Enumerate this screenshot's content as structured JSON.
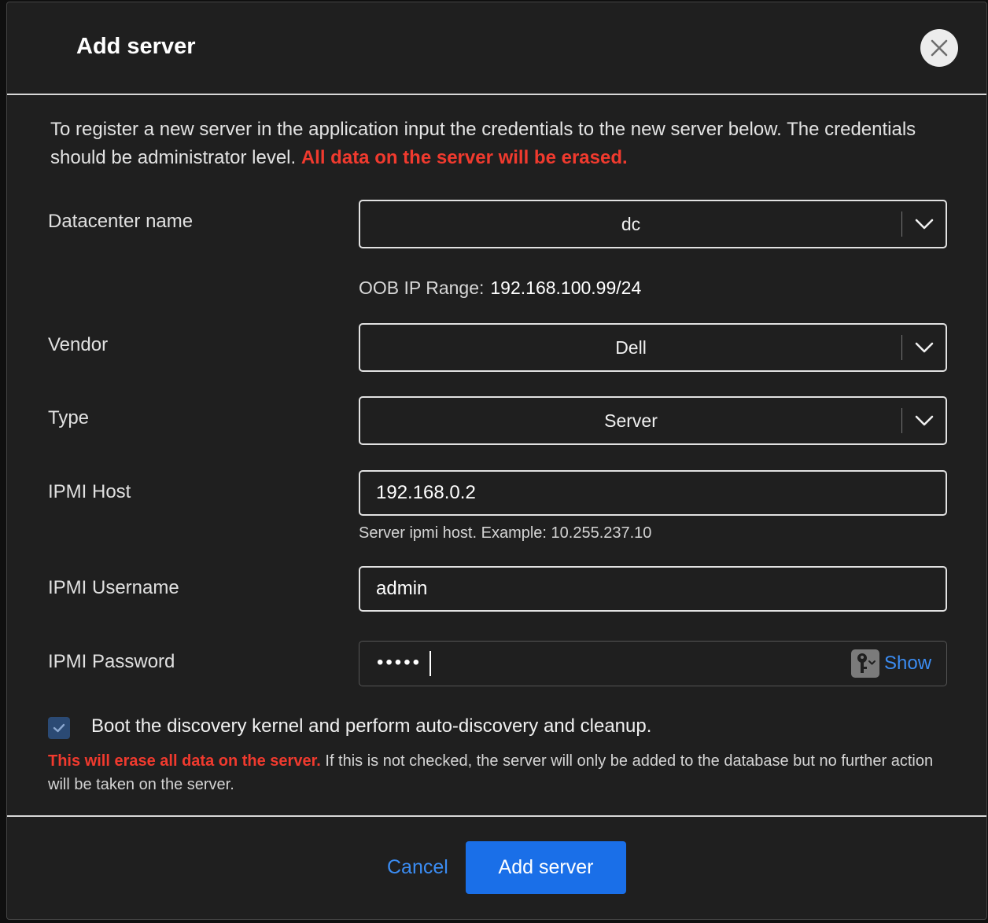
{
  "modal": {
    "title": "Add server",
    "intro_text": "To register a new server in the application input the credentials to the new server below. The credentials should be administrator level.",
    "intro_warning": "All data on the server will be erased."
  },
  "form": {
    "datacenter": {
      "label": "Datacenter name",
      "value": "dc"
    },
    "oob": {
      "label": "OOB IP Range:",
      "value": "192.168.100.99/24"
    },
    "vendor": {
      "label": "Vendor",
      "value": "Dell"
    },
    "type": {
      "label": "Type",
      "value": "Server"
    },
    "ipmi_host": {
      "label": "IPMI Host",
      "value": "192.168.0.2",
      "hint": "Server ipmi host. Example: 10.255.237.10"
    },
    "ipmi_username": {
      "label": "IPMI Username",
      "value": "admin"
    },
    "ipmi_password": {
      "label": "IPMI Password",
      "masked_value": "•••••",
      "show_label": "Show"
    },
    "discovery": {
      "checked": true,
      "label": "Boot the discovery kernel and perform auto-discovery and cleanup.",
      "warning": "This will erase all data on the server.",
      "note": "If this is not checked, the server will only be added to the database but no further action will be taken on the server."
    }
  },
  "footer": {
    "cancel_label": "Cancel",
    "submit_label": "Add server"
  },
  "colors": {
    "accent": "#1a6fe8",
    "link": "#3b8cf2",
    "danger": "#f03a2e",
    "background": "#1f1f1f"
  }
}
